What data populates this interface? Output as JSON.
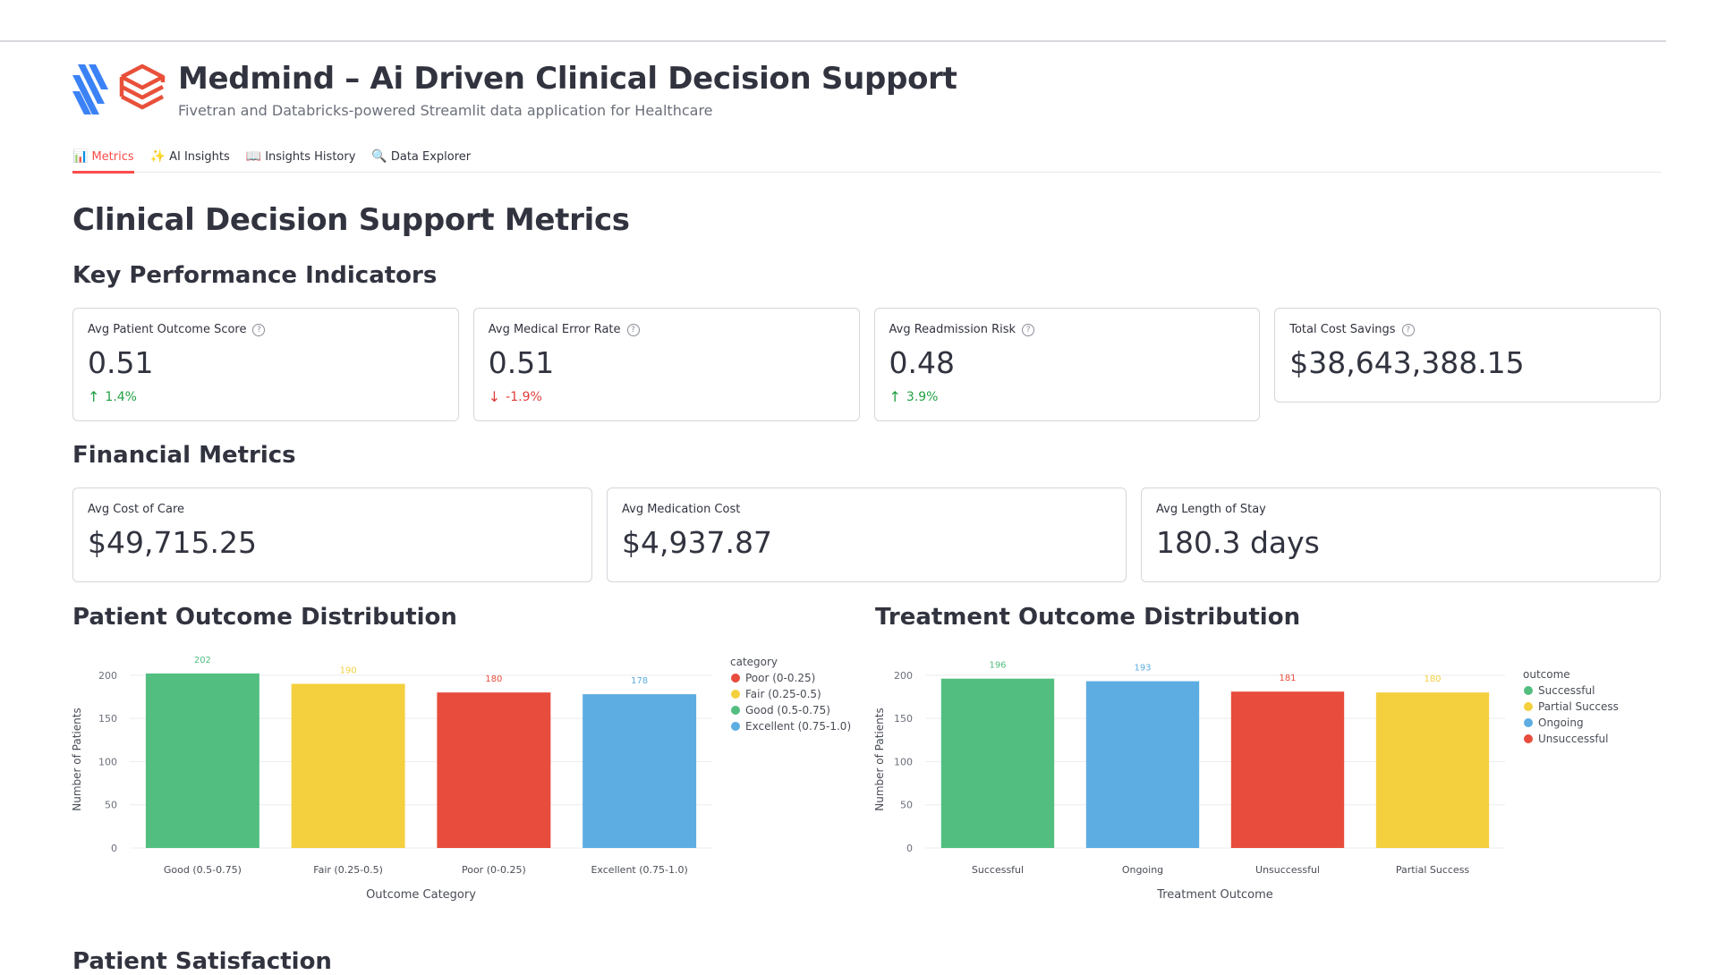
{
  "header": {
    "title": "Medmind – Ai Driven Clinical Decision Support",
    "subtitle": "Fivetran and Databricks-powered Streamlit data application for Healthcare"
  },
  "tabs": [
    {
      "label": "Metrics",
      "icon": "bar-chart-icon",
      "glyph": "📊",
      "active": true
    },
    {
      "label": "AI Insights",
      "icon": "sparkles-icon",
      "glyph": "✨",
      "active": false
    },
    {
      "label": "Insights History",
      "icon": "book-icon",
      "glyph": "📖",
      "active": false
    },
    {
      "label": "Data Explorer",
      "icon": "magnifier-icon",
      "glyph": "🔍",
      "active": false
    }
  ],
  "page_title": "Clinical Decision Support Metrics",
  "kpi": {
    "heading": "Key Performance Indicators",
    "cards": [
      {
        "label": "Avg Patient Outcome Score",
        "value": "0.51",
        "delta": "1.4%",
        "direction": "up"
      },
      {
        "label": "Avg Medical Error Rate",
        "value": "0.51",
        "delta": "-1.9%",
        "direction": "down"
      },
      {
        "label": "Avg Readmission Risk",
        "value": "0.48",
        "delta": "3.9%",
        "direction": "up"
      },
      {
        "label": "Total Cost Savings",
        "value": "$38,643,388.15"
      }
    ]
  },
  "financial": {
    "heading": "Financial Metrics",
    "cards": [
      {
        "label": "Avg Cost of Care",
        "value": "$49,715.25"
      },
      {
        "label": "Avg Medication Cost",
        "value": "$4,937.87"
      },
      {
        "label": "Avg Length of Stay",
        "value": "180.3 days"
      }
    ]
  },
  "sections": {
    "patient_outcome": "Patient Outcome Distribution",
    "treatment_outcome": "Treatment Outcome Distribution",
    "patient_satisfaction": "Patient Satisfaction"
  },
  "colors": {
    "green": "#52be80",
    "yellow": "#f4d03f",
    "red": "#e74c3c",
    "blue": "#5dade2",
    "accent": "#ff4b4b"
  },
  "chart_data": [
    {
      "type": "bar",
      "categories": [
        "Good (0.5-0.75)",
        "Fair (0.25-0.5)",
        "Poor (0-0.25)",
        "Excellent (0.75-1.0)"
      ],
      "values": [
        202,
        190,
        180,
        178
      ],
      "bar_colors": [
        "#52be80",
        "#f4d03f",
        "#e74c3c",
        "#5dade2"
      ],
      "xlabel": "Outcome Category",
      "ylabel": "Number of Patients",
      "ylim": [
        0,
        205
      ],
      "yticks": [
        0,
        50,
        100,
        150,
        200
      ],
      "grid": true,
      "legend": {
        "title": "category",
        "placement": "right",
        "items": [
          {
            "label": "Poor (0-0.25)",
            "color": "#e74c3c"
          },
          {
            "label": "Fair (0.25-0.5)",
            "color": "#f4d03f"
          },
          {
            "label": "Good (0.5-0.75)",
            "color": "#52be80"
          },
          {
            "label": "Excellent (0.75-1.0)",
            "color": "#5dade2"
          }
        ]
      }
    },
    {
      "type": "bar",
      "categories": [
        "Successful",
        "Ongoing",
        "Unsuccessful",
        "Partial Success"
      ],
      "values": [
        196,
        193,
        181,
        180
      ],
      "bar_colors": [
        "#52be80",
        "#5dade2",
        "#e74c3c",
        "#f4d03f"
      ],
      "xlabel": "Treatment Outcome",
      "ylabel": "Number of Patients",
      "ylim": [
        0,
        205
      ],
      "yticks": [
        0,
        50,
        100,
        150,
        200
      ],
      "grid": true,
      "legend": {
        "title": "outcome",
        "placement": "right",
        "items": [
          {
            "label": "Successful",
            "color": "#52be80"
          },
          {
            "label": "Partial Success",
            "color": "#f4d03f"
          },
          {
            "label": "Ongoing",
            "color": "#5dade2"
          },
          {
            "label": "Unsuccessful",
            "color": "#e74c3c"
          }
        ]
      }
    }
  ]
}
